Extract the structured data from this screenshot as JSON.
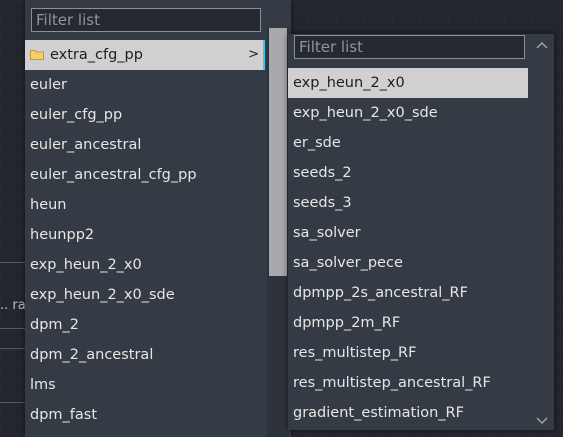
{
  "background": {
    "fragment_text": ".. ra"
  },
  "menu_main": {
    "filter_placeholder": "Filter list",
    "items": [
      {
        "label": "extra_cfg_pp",
        "icon": "folder-icon",
        "submenu_arrow": ">",
        "highlighted": true
      },
      {
        "label": "euler"
      },
      {
        "label": "euler_cfg_pp"
      },
      {
        "label": "euler_ancestral"
      },
      {
        "label": "euler_ancestral_cfg_pp"
      },
      {
        "label": "heun"
      },
      {
        "label": "heunpp2"
      },
      {
        "label": "exp_heun_2_x0"
      },
      {
        "label": "exp_heun_2_x0_sde"
      },
      {
        "label": "dpm_2"
      },
      {
        "label": "dpm_2_ancestral"
      },
      {
        "label": "lms"
      },
      {
        "label": "dpm_fast"
      }
    ]
  },
  "menu_sub": {
    "filter_placeholder": "Filter list",
    "items": [
      {
        "label": "exp_heun_2_x0",
        "highlighted": true
      },
      {
        "label": "exp_heun_2_x0_sde"
      },
      {
        "label": "er_sde"
      },
      {
        "label": "seeds_2"
      },
      {
        "label": "seeds_3"
      },
      {
        "label": "sa_solver"
      },
      {
        "label": "sa_solver_pece"
      },
      {
        "label": "dpmpp_2s_ancestral_RF"
      },
      {
        "label": "dpmpp_2m_RF"
      },
      {
        "label": "res_multistep_RF"
      },
      {
        "label": "res_multistep_ancestral_RF"
      },
      {
        "label": "gradient_estimation_RF"
      }
    ]
  },
  "colors": {
    "menu_bg": "#353b44",
    "highlight_bg": "#d0d0d0",
    "accent": "#41c4e8",
    "folder": "#f0c15a"
  }
}
